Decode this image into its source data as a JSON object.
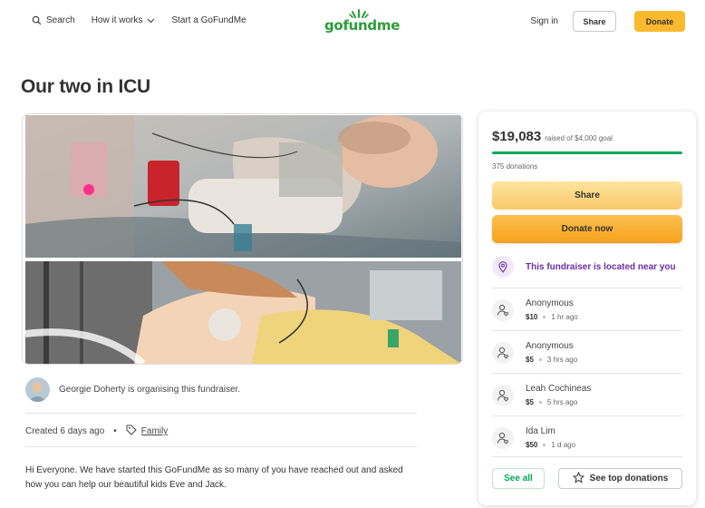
{
  "header": {
    "search_label": "Search",
    "how_it_works_label": "How it works",
    "start_label": "Start a GoFundMe",
    "logo_text": "gofundme",
    "signin_label": "Sign in",
    "share_label": "Share",
    "donate_label": "Donate"
  },
  "campaign": {
    "title": "Our two in ICU",
    "organiser_text": "Georgie Doherty is organising this fundraiser.",
    "created_text": "Created 6 days ago",
    "category": "Family",
    "story": "Hi Everyone. We have started this GoFundMe as so many of you have reached out and asked how you can help our beautiful kids Eve and Jack."
  },
  "sidebar": {
    "raised_amount": "$19,083",
    "goal_text": "raised of $4,000 goal",
    "progress_fraction": 1.0,
    "donation_count": "375 donations",
    "share_label": "Share",
    "donate_label": "Donate now",
    "location_text": "This fundraiser is located near you",
    "donations": [
      {
        "name": "Anonymous",
        "amount": "$10",
        "time": "1 hr ago"
      },
      {
        "name": "Anonymous",
        "amount": "$5",
        "time": "3 hrs ago"
      },
      {
        "name": "Leah Cochineas",
        "amount": "$5",
        "time": "5 hrs ago"
      },
      {
        "name": "Ida Lim",
        "amount": "$50",
        "time": "1 d ago"
      }
    ],
    "see_all_label": "See all",
    "top_donations_label": "See top donations"
  },
  "colors": {
    "brand_green": "#02a95c",
    "donate_yellow": "#fbb92d",
    "location_purple": "#6b2fa3"
  }
}
